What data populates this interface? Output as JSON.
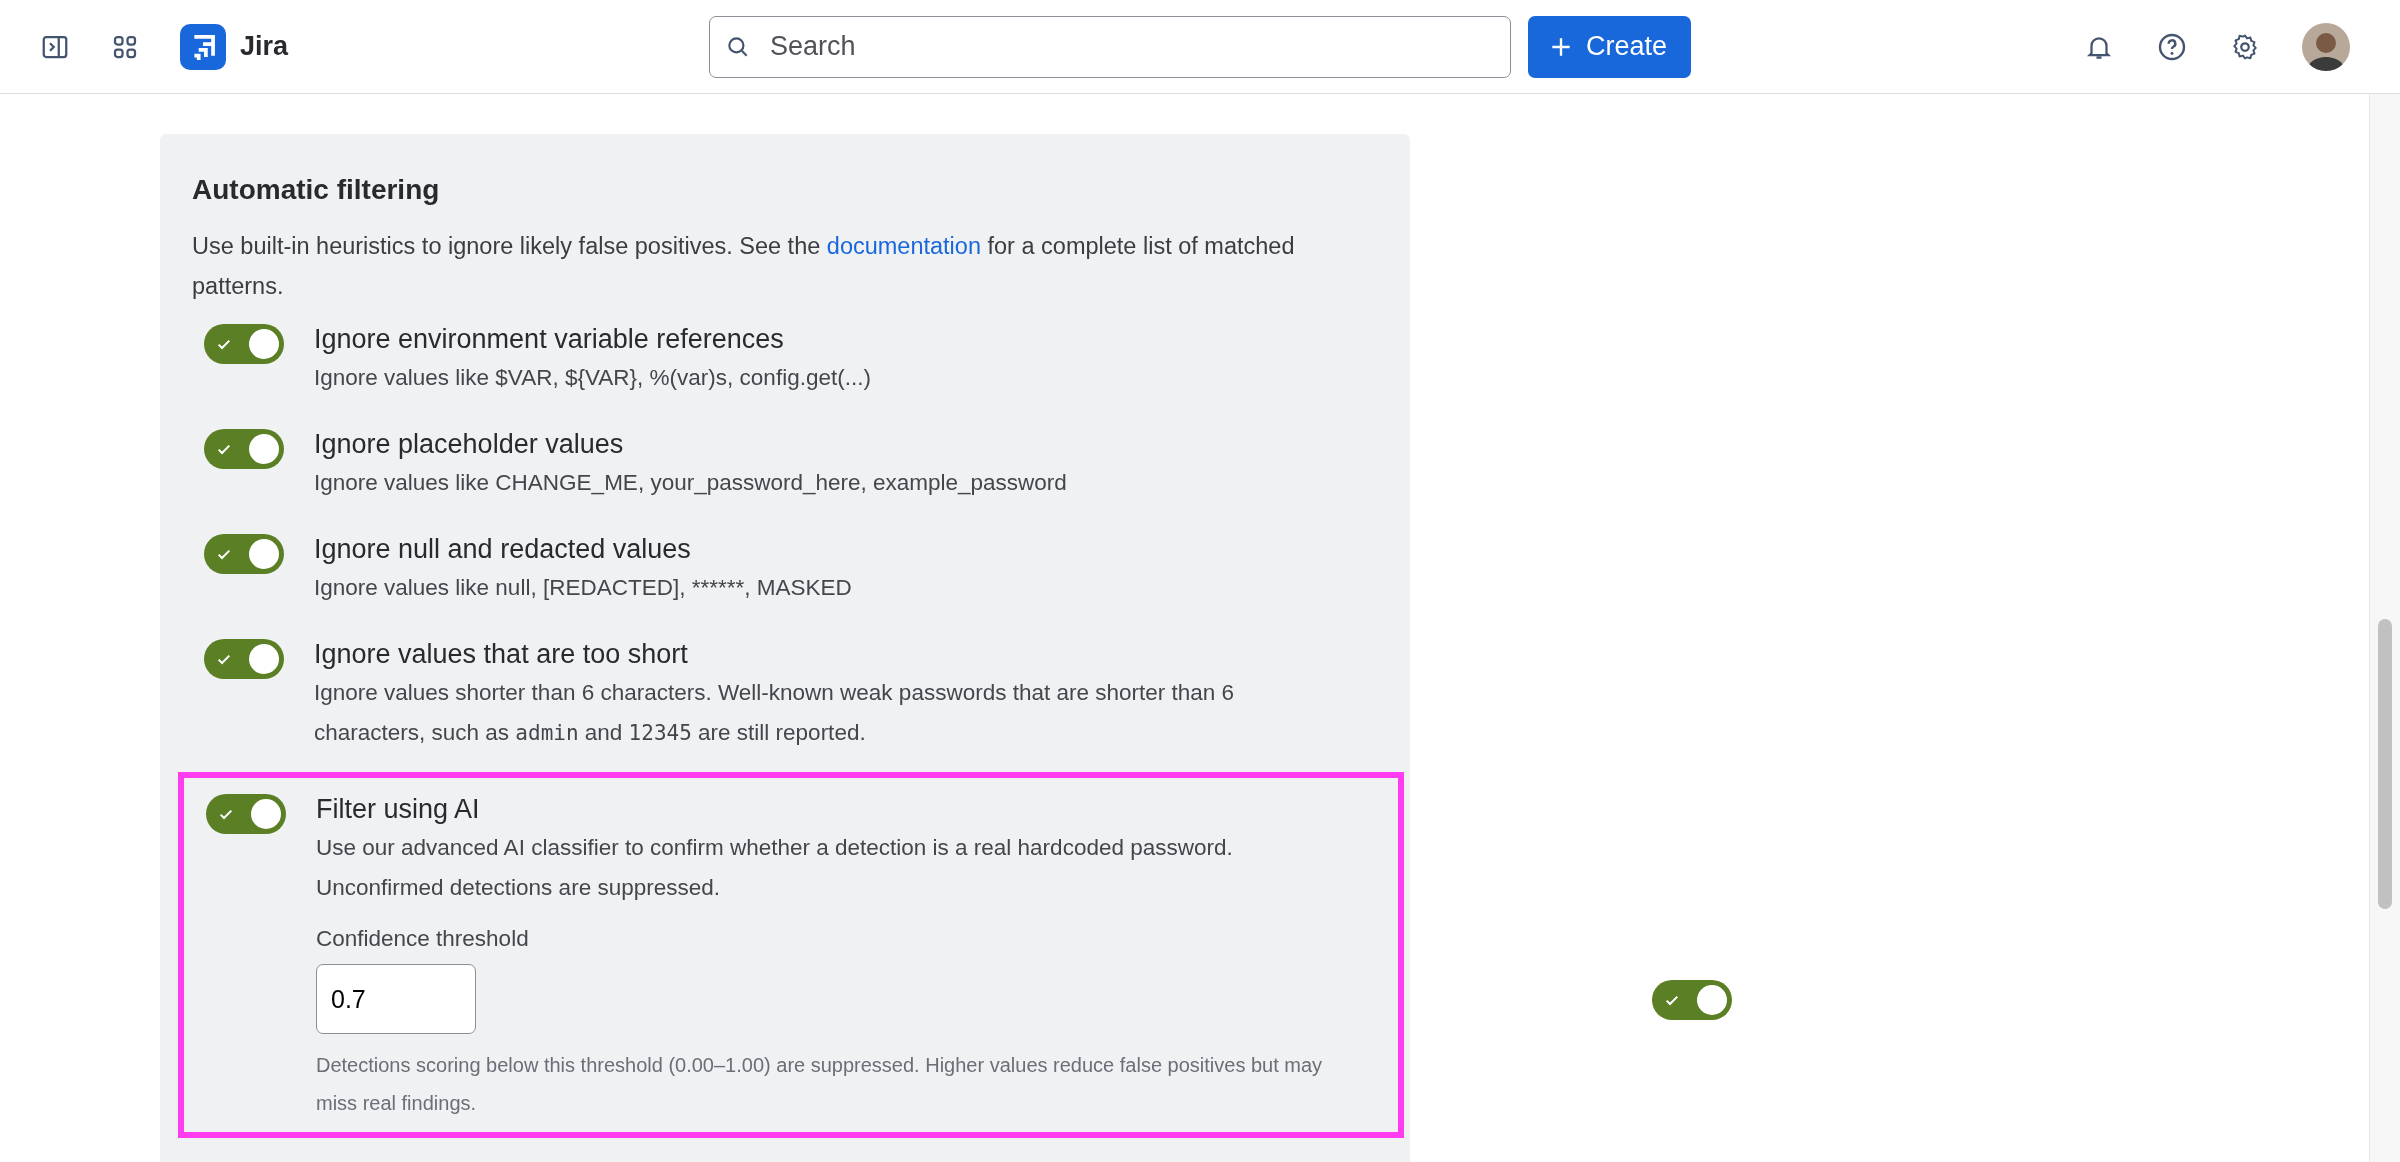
{
  "header": {
    "app_name": "Jira",
    "search": {
      "placeholder": "Search"
    },
    "create_button": {
      "label": "Create"
    }
  },
  "panel": {
    "title": "Automatic filtering",
    "description": [
      {
        "kind": "text",
        "text": "Use built-in heuristics to ignore likely false positives. See the "
      },
      {
        "kind": "link",
        "text": "documentation"
      },
      {
        "kind": "text",
        "text": " for a complete list of matched patterns."
      }
    ],
    "options": [
      {
        "title": "Ignore environment variable references",
        "on": true,
        "highlighted": false,
        "description": [
          {
            "kind": "text",
            "text": "Ignore values like $VAR, ${VAR}, %(var)s, config.get(...)"
          }
        ]
      },
      {
        "title": "Ignore placeholder values",
        "on": true,
        "highlighted": false,
        "description": [
          {
            "kind": "text",
            "text": "Ignore values like CHANGE_ME, your_password_here, example_password"
          }
        ]
      },
      {
        "title": "Ignore null and redacted values",
        "on": true,
        "highlighted": false,
        "description": [
          {
            "kind": "text",
            "text": "Ignore values like null, [REDACTED], ******, MASKED"
          }
        ]
      },
      {
        "title": "Ignore values that are too short",
        "on": true,
        "highlighted": false,
        "description": [
          {
            "kind": "text",
            "text": "Ignore values shorter than 6 characters. Well-known weak passwords that are shorter than 6 characters, such as "
          },
          {
            "kind": "code",
            "text": "admin"
          },
          {
            "kind": "text",
            "text": " and "
          },
          {
            "kind": "code",
            "text": "12345"
          },
          {
            "kind": "text",
            "text": " are still reported."
          }
        ]
      },
      {
        "title": "Filter using AI",
        "on": true,
        "highlighted": true,
        "description": [
          {
            "kind": "text",
            "text": "Use our advanced AI classifier to confirm whether a detection is a real hardcoded password. Unconfirmed detections are suppressed."
          }
        ],
        "threshold": {
          "label": "Confidence threshold",
          "value": "0.7",
          "note": "Detections scoring below this threshold (0.00–1.00) are suppressed. Higher values reduce false positives but may miss real findings."
        }
      }
    ]
  },
  "floating_toggle": {
    "on": true
  }
}
